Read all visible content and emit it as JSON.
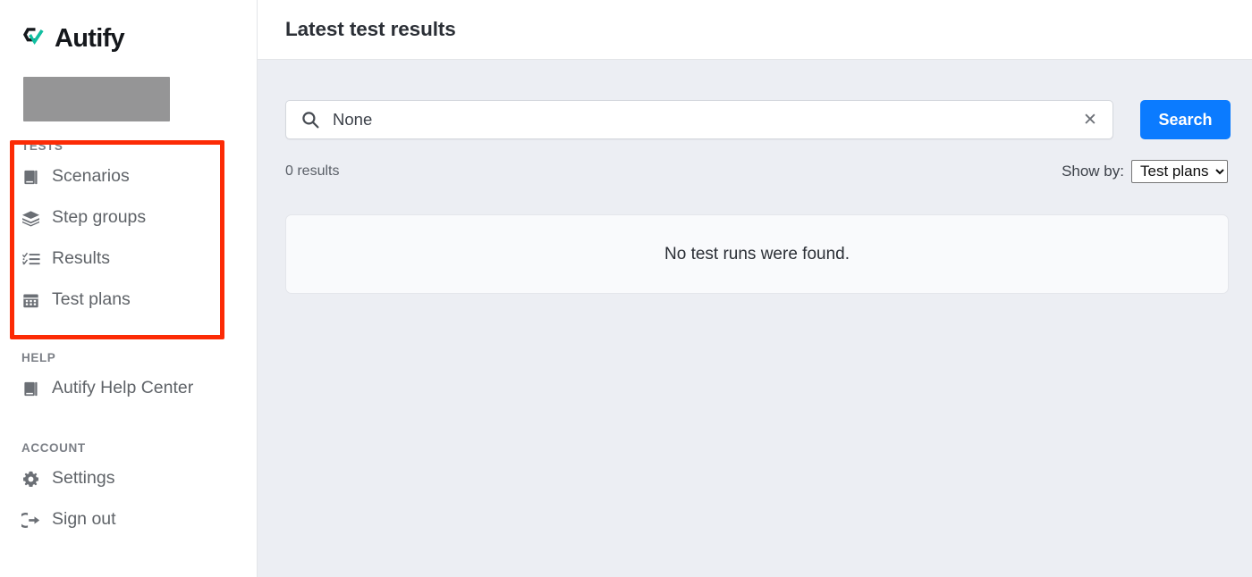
{
  "sidebar": {
    "logo": {
      "icon": "autify-hexagon-check-logo",
      "text": "Autify",
      "mark_color": "#0fb9a0",
      "text_color": "#15181c"
    },
    "org_placeholder": {
      "label": "",
      "color": "#959596"
    },
    "sections": [
      {
        "title": "TESTS",
        "items": [
          {
            "label": "Scenarios",
            "icon": "book-icon"
          },
          {
            "label": "Step groups",
            "icon": "layers-icon"
          },
          {
            "label": "Results",
            "icon": "checklist-icon"
          },
          {
            "label": "Test plans",
            "icon": "calendar-icon"
          }
        ]
      },
      {
        "title": "HELP",
        "items": [
          {
            "label": "Autify Help Center",
            "icon": "book-icon"
          }
        ]
      },
      {
        "title": "ACCOUNT",
        "items": [
          {
            "label": "Settings",
            "icon": "gear-icon"
          },
          {
            "label": "Sign out",
            "icon": "sign-out-icon"
          }
        ]
      }
    ]
  },
  "annotation": {
    "name": "red-highlight-box",
    "color": "#fc2b05"
  },
  "header": {
    "title": "Latest test results"
  },
  "search": {
    "icon": "search-icon",
    "value": "None",
    "placeholder": "",
    "clear_icon": "close-icon",
    "clear_glyph": "✕",
    "button_label": "Search",
    "button_color": "#0b7bff"
  },
  "meta": {
    "results_count": "0 results",
    "show_by_label": "Show by:",
    "show_by_value": "Test plans",
    "show_by_options": [
      "Test plans"
    ]
  },
  "empty_state": {
    "message": "No test runs were found."
  }
}
